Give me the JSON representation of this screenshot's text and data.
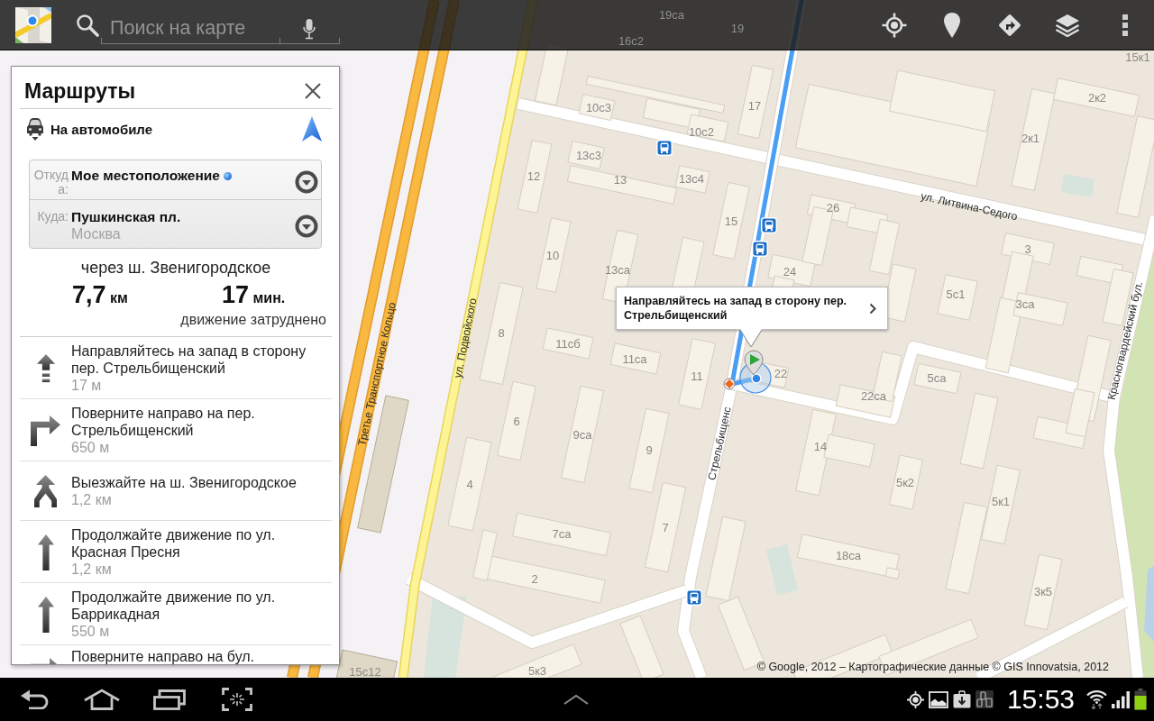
{
  "top_bar": {
    "search": {
      "placeholder": "Поиск на карте"
    }
  },
  "directions_panel": {
    "title": "Маршруты",
    "travel_mode": {
      "label": "На автомобиле"
    },
    "from": {
      "label": "Откуда:",
      "value": "Мое местоположение"
    },
    "to": {
      "label": "Куда:",
      "value": "Пушкинская пл.",
      "detail": "Москва"
    },
    "summary": {
      "via": "через ш. Звенигородское",
      "distance": {
        "value": "7,7",
        "unit": "км"
      },
      "duration": {
        "value": "17",
        "unit": "мин."
      },
      "traffic": "движение затруднено"
    },
    "steps": [
      {
        "kind": "depart",
        "text": "Направляйтесь на запад в сторону пер. Стрельбищенский",
        "distance": "17 м"
      },
      {
        "kind": "turn-right",
        "text": "Поверните направо на пер. Стрельбищенский",
        "distance": "650 м"
      },
      {
        "kind": "merge",
        "text": "Выезжайте на ш. Звенигородское",
        "distance": "1,2 км"
      },
      {
        "kind": "straight",
        "text": "Продолжайте движение по ул. Красная Пресня",
        "distance": "1,2 км"
      },
      {
        "kind": "straight",
        "text": "Продолжайте движение по ул. Баррикадная",
        "distance": "550 м"
      },
      {
        "kind": "turn-right",
        "text": "Поверните направо на бул."
      }
    ]
  },
  "map": {
    "house_numbers": [
      "19са",
      "19",
      "16с2",
      "15к1",
      "2к2",
      "10с3",
      "17",
      "10с2",
      "2к1",
      "13с3",
      "12",
      "13",
      "13с4",
      "26",
      "15",
      "10",
      "3",
      "13са",
      "24",
      "5с1",
      "3са",
      "8",
      "11сб",
      "11са",
      "11",
      "22",
      "5са",
      "22са",
      "6",
      "9са",
      "9",
      "14",
      "4",
      "5к2",
      "5к1",
      "7са",
      "7",
      "18са",
      "2",
      "3к5",
      "15с12",
      "5к3"
    ],
    "street_names": [
      "Третье Транспортное Кольцо",
      "ул. Подвойского",
      "ул. Литвина-Седого",
      "Стрельбищенс",
      "Красногвардейский бул."
    ],
    "callout": {
      "text": "Направляйтесь на запад в сторону пер. Стрельбищенский"
    },
    "attribution": "© Google, 2012 – Картографические данные © GIS Innovatsia, 2012"
  },
  "system_bar": {
    "time": "15:53"
  }
}
